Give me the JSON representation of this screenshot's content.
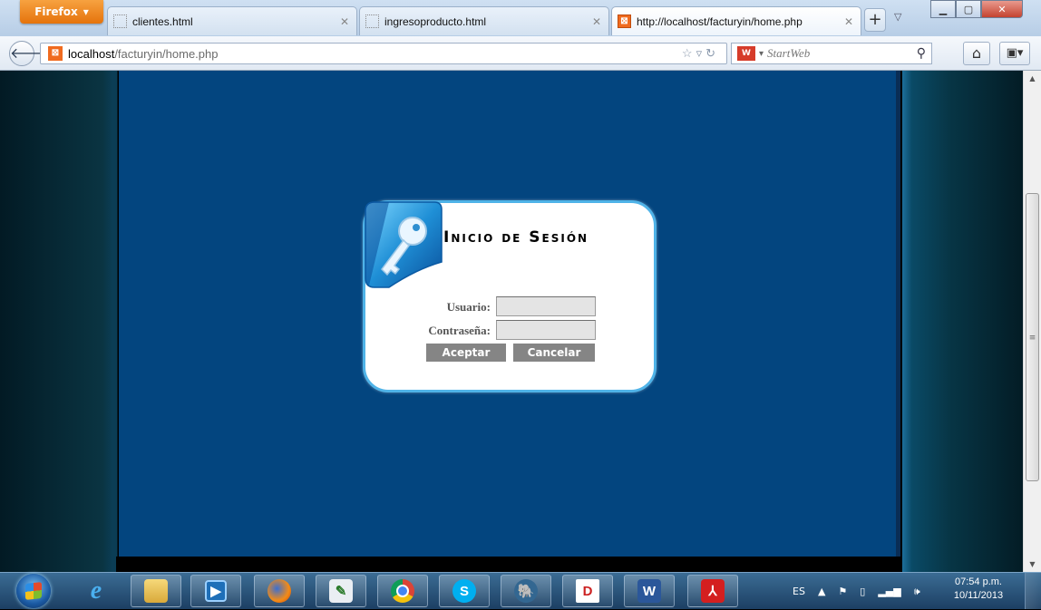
{
  "browser": {
    "menu_label": "Firefox",
    "tabs": [
      {
        "title": "clientes.html"
      },
      {
        "title": "ingresoproducto.html"
      },
      {
        "title": "http://localhost/facturyin/home.php"
      }
    ],
    "url_host": "localhost",
    "url_path": "/facturyin/home.php",
    "search_placeholder": "StartWeb"
  },
  "login": {
    "title": "Inicio de Sesión",
    "user_label": "Usuario:",
    "password_label": "Contraseña:",
    "user_value": "",
    "password_value": "",
    "accept_label": "Aceptar",
    "cancel_label": "Cancelar"
  },
  "taskbar": {
    "language": "ES",
    "time": "07:54 p.m.",
    "date": "10/11/2013",
    "apps": [
      "internet-explorer-icon",
      "file-explorer-icon",
      "media-player-icon",
      "firefox-icon",
      "notepad-icon",
      "chrome-icon",
      "skype-icon",
      "postgresql-icon",
      "pgadmin-icon",
      "word-icon",
      "acrobat-icon"
    ]
  },
  "colors": {
    "page_bg": "#03457f",
    "login_border": "#4fb3e8",
    "button_bg": "#858585"
  }
}
